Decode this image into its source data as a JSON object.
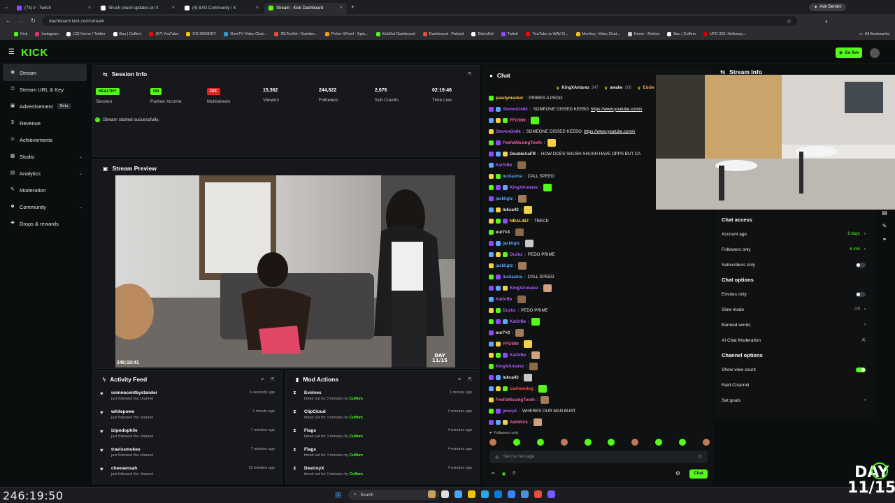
{
  "browser": {
    "tabs": [
      {
        "title": "(73) // - Twitch",
        "color": "#9147ff",
        "active": false
      },
      {
        "title": "Shush shush updates on X",
        "color": "#ffffff",
        "active": false
      },
      {
        "title": "(4) BAU Community / X",
        "color": "#ffffff",
        "active": false
      },
      {
        "title": "Stream - Kick Dashboard",
        "color": "#53fc18",
        "active": true
      }
    ],
    "url": "dashboard.kick.com/stream",
    "ask_gemini": "Ask Gemini",
    "bookmarks": [
      {
        "label": "Kick",
        "color": "#53fc18"
      },
      {
        "label": "Instagram",
        "color": "#e1306c"
      },
      {
        "label": "(12) Home / Twitter",
        "color": "#ffffff"
      },
      {
        "label": "Bau | Cuffem",
        "color": "#ffffff"
      },
      {
        "label": "(57) YouTube",
        "color": "#ff0000"
      },
      {
        "label": "OG MONKEY",
        "color": "#f1c40f"
      },
      {
        "label": "OmeTV Video Chat...",
        "color": "#3498db"
      },
      {
        "label": "IRLToolkit • Dashbo...",
        "color": "#e74c3c"
      },
      {
        "label": "Picker Wheel - Spin...",
        "color": "#f39c12"
      },
      {
        "label": "KickBot Dashboard",
        "color": "#53fc18"
      },
      {
        "label": "Dashboard - Pulsoid",
        "color": "#e74c3c"
      },
      {
        "label": "DistroKid",
        "color": "#ffffff"
      },
      {
        "label": "Twitch",
        "color": "#9147ff"
      },
      {
        "label": "YouTube to WAV D...",
        "color": "#ff0000"
      },
      {
        "label": "Monkey: Video Chat...",
        "color": "#f1c40f"
      },
      {
        "label": "Home - Roblox",
        "color": "#cccccc"
      },
      {
        "label": "Bau | Cuffem",
        "color": "#ffffff"
      },
      {
        "label": "UFC 326: Holloway...",
        "color": "#d00000"
      }
    ],
    "all_bookmarks": "All Bookmarks"
  },
  "header": {
    "logo": "KICK",
    "go_live": "Go live"
  },
  "sidebar": {
    "items": [
      {
        "label": "Stream",
        "icon": "broadcast-icon",
        "glyph": "◉",
        "active": true,
        "badge": "",
        "chevron": false
      },
      {
        "label": "Stream URL & Key",
        "icon": "key-icon",
        "glyph": "⚿",
        "active": false,
        "badge": "",
        "chevron": false
      },
      {
        "label": "Advertisement",
        "icon": "megaphone-icon",
        "glyph": "▣",
        "active": false,
        "badge": "Beta",
        "chevron": false
      },
      {
        "label": "Revenue",
        "icon": "dollar-icon",
        "glyph": "$",
        "active": false,
        "badge": "",
        "chevron": false
      },
      {
        "label": "Achievements",
        "icon": "trophy-icon",
        "glyph": "♔",
        "active": false,
        "badge": "",
        "chevron": false
      },
      {
        "label": "Studio",
        "icon": "studio-icon",
        "glyph": "▦",
        "active": false,
        "badge": "",
        "chevron": true
      },
      {
        "label": "Analytics",
        "icon": "analytics-icon",
        "glyph": "▤",
        "active": false,
        "badge": "",
        "chevron": true
      },
      {
        "label": "Moderation",
        "icon": "wrench-icon",
        "glyph": "✎",
        "active": false,
        "badge": "",
        "chevron": false
      },
      {
        "label": "Community",
        "icon": "community-icon",
        "glyph": "☻",
        "active": false,
        "badge": "",
        "chevron": true
      },
      {
        "label": "Drops & rewards",
        "icon": "gift-icon",
        "glyph": "✚",
        "active": false,
        "badge": "",
        "chevron": false
      }
    ]
  },
  "session": {
    "title": "Session Info",
    "stats": [
      {
        "value": "HEALTHY",
        "label": "Session",
        "badge": true,
        "color": "#53fc18"
      },
      {
        "value": "ON",
        "label": "Partner Income",
        "badge": true,
        "color": "#53fc18"
      },
      {
        "value": "OFF",
        "label": "Multistream",
        "badge": true,
        "color": "#e02424"
      },
      {
        "value": "15,362",
        "label": "Viewers",
        "badge": false
      },
      {
        "value": "244,622",
        "label": "Followers",
        "badge": false
      },
      {
        "value": "2,676",
        "label": "Sub Counts",
        "badge": false
      },
      {
        "value": "02:19:46",
        "label": "Time Live",
        "badge": false
      }
    ],
    "status": "Stream started successfully."
  },
  "preview": {
    "title": "Stream Preview",
    "timestamp": "246:19:41",
    "day": "DAY",
    "day_num": "11/15"
  },
  "activity": {
    "title": "Activity Feed",
    "items": [
      {
        "name": "uninnocentbystander",
        "sub": "just followed the channel",
        "time": "6 seconds ago"
      },
      {
        "name": "whitepowe",
        "sub": "just followed the channel",
        "time": "1 minute ago"
      },
      {
        "name": "izipedophile",
        "sub": "just followed the channel",
        "time": "7 minutes ago"
      },
      {
        "name": "travissmokes",
        "sub": "just followed the channel",
        "time": "7 minutes ago"
      },
      {
        "name": "cheesensah",
        "sub": "just followed the channel",
        "time": "10 minutes ago"
      }
    ]
  },
  "mod": {
    "title": "Mod Actions",
    "items": [
      {
        "name": "Evolves",
        "sub": "timed out for 3 minutes by",
        "by": "Cuffem",
        "time": "1 minute ago"
      },
      {
        "name": "ClipCloud",
        "sub": "timed out for 3 minutes by",
        "by": "Cuffem",
        "time": "4 minutes ago"
      },
      {
        "name": "Flags",
        "sub": "timed out for 3 minutes by",
        "by": "Cuffem",
        "time": "4 minutes ago"
      },
      {
        "name": "Flags",
        "sub": "timed out for 3 minutes by",
        "by": "Cuffem",
        "time": "4 minutes ago"
      },
      {
        "name": "DestroyX",
        "sub": "timed out for 3 minutes by",
        "by": "Cuffem",
        "time": "4 minutes ago"
      }
    ]
  },
  "chat": {
    "title": "Chat",
    "pinned": [
      {
        "name": "KingXAntarez",
        "count": "247"
      },
      {
        "name": "awake",
        "count": "100"
      },
      {
        "name": "Eddie",
        "count": ""
      }
    ],
    "messages": [
      {
        "user": "pasdymacker",
        "color": "#f5d142",
        "text": "PRIMES A PEDO",
        "link": "",
        "emote": false
      },
      {
        "user": "StevenOn8k",
        "color": "#b05cff",
        "text": "SOMEONE DISSED KEEBO",
        "link": "https://www.youtube.com/v",
        "emote": false
      },
      {
        "user": "FFG999",
        "color": "#ff5ca8",
        "text": "",
        "link": "",
        "emote": true
      },
      {
        "user": "StevenOn8k",
        "color": "#b05cff",
        "text": "SOMEONE DISSED KEEBO",
        "link": "https://www.youtube.com/v",
        "emote": false
      },
      {
        "user": "FeefsMissingTooth",
        "color": "#ff5ca8",
        "text": "",
        "link": "",
        "emote": true
      },
      {
        "user": "DoubleAaFR",
        "color": "#e6e6e6",
        "text": "HOW DOES SHUSH SHUSH HAVE OPPS BUT CA",
        "link": "",
        "emote": false
      },
      {
        "user": "Kal3rBe",
        "color": "#b05cff",
        "text": "",
        "link": "",
        "emote": true
      },
      {
        "user": "luckazma",
        "color": "#5ca8ff",
        "text": "CALL SPEED",
        "link": "",
        "emote": false
      },
      {
        "user": "KingXAntarez",
        "color": "#b05cff",
        "text": "",
        "link": "",
        "emote": true
      },
      {
        "user": "jackkgtz",
        "color": "#5ca8ff",
        "text": "",
        "link": "",
        "emote": true
      },
      {
        "user": "lukca43",
        "color": "#e6e6e6",
        "text": "",
        "link": "",
        "emote": true
      },
      {
        "user": "NBALIBZ",
        "color": "#f5d142",
        "text": "TRECE",
        "link": "",
        "emote": false
      },
      {
        "user": "eur7×3",
        "color": "#e6e6e6",
        "text": "",
        "link": "",
        "emote": true
      },
      {
        "user": "jackkgtz",
        "color": "#5ca8ff",
        "text": "",
        "link": "",
        "emote": true
      },
      {
        "user": "Duzbz",
        "color": "#b05cff",
        "text": "PEDO PRIME",
        "link": "",
        "emote": false
      },
      {
        "user": "jackkgtz",
        "color": "#5ca8ff",
        "text": "",
        "link": "",
        "emote": true
      },
      {
        "user": "luckazma",
        "color": "#5ca8ff",
        "text": "CALL SPEED",
        "link": "",
        "emote": false
      },
      {
        "user": "KingXAntarez",
        "color": "#b05cff",
        "text": "",
        "link": "",
        "emote": true
      },
      {
        "user": "Kal3rBe",
        "color": "#b05cff",
        "text": "",
        "link": "",
        "emote": true
      },
      {
        "user": "Duzbz",
        "color": "#b05cff",
        "text": "PEDO PRIME",
        "link": "",
        "emote": false
      },
      {
        "user": "Kal3rBe",
        "color": "#b05cff",
        "text": "",
        "link": "",
        "emote": true
      },
      {
        "user": "eur7×3",
        "color": "#e6e6e6",
        "text": "",
        "link": "",
        "emote": true
      },
      {
        "user": "FFG999",
        "color": "#ff5ca8",
        "text": "",
        "link": "",
        "emote": true
      },
      {
        "user": "Kal3rBe",
        "color": "#b05cff",
        "text": "",
        "link": "",
        "emote": true
      },
      {
        "user": "KingXAntarez",
        "color": "#b05cff",
        "text": "",
        "link": "",
        "emote": true
      },
      {
        "user": "lukca43",
        "color": "#e6e6e6",
        "text": "",
        "link": "",
        "emote": true
      },
      {
        "user": "cashewdog",
        "color": "#ff4d4d",
        "text": "",
        "link": "",
        "emote": true
      },
      {
        "user": "FeefsMissingTooth",
        "color": "#ff5ca8",
        "text": "",
        "link": "",
        "emote": true
      },
      {
        "user": "jewcyk",
        "color": "#b05cff",
        "text": "WHERES OUR MAN BURT",
        "link": "",
        "emote": false
      },
      {
        "user": "AdinKirk",
        "color": "#ff5ca8",
        "text": "",
        "link": "",
        "emote": true
      }
    ],
    "followers_only": "Followers only",
    "placeholder": "Send a message",
    "points": "0",
    "send": "Chat"
  },
  "right": {
    "stream_info": "Stream Info",
    "chat_access": "Chat access",
    "access_rows": [
      {
        "label": "Account age",
        "value": "6 days",
        "kind": "link"
      },
      {
        "label": "Followers only",
        "value": "6 min",
        "kind": "link"
      },
      {
        "label": "Subscribers only",
        "value": "",
        "kind": "toggle-off"
      }
    ],
    "chat_options": "Chat options",
    "option_rows": [
      {
        "label": "Emotes only",
        "value": "",
        "kind": "toggle-off"
      },
      {
        "label": "Slow mode",
        "value": "Off",
        "kind": "link-grey"
      },
      {
        "label": "Banned words",
        "value": "",
        "kind": "chevron"
      },
      {
        "label": "AI Chat Moderation",
        "value": "",
        "kind": "external"
      }
    ],
    "channel_options": "Channel options",
    "channel_rows": [
      {
        "label": "Show view count",
        "value": "",
        "kind": "toggle-on"
      },
      {
        "label": "Raid Channel",
        "value": "",
        "kind": "none"
      },
      {
        "label": "Set goals",
        "value": "",
        "kind": "chevron"
      }
    ]
  },
  "overlay": {
    "timer": "246:19:50",
    "day": "DAY",
    "day_num": "11/15"
  },
  "taskbar": {
    "search": "Search"
  }
}
